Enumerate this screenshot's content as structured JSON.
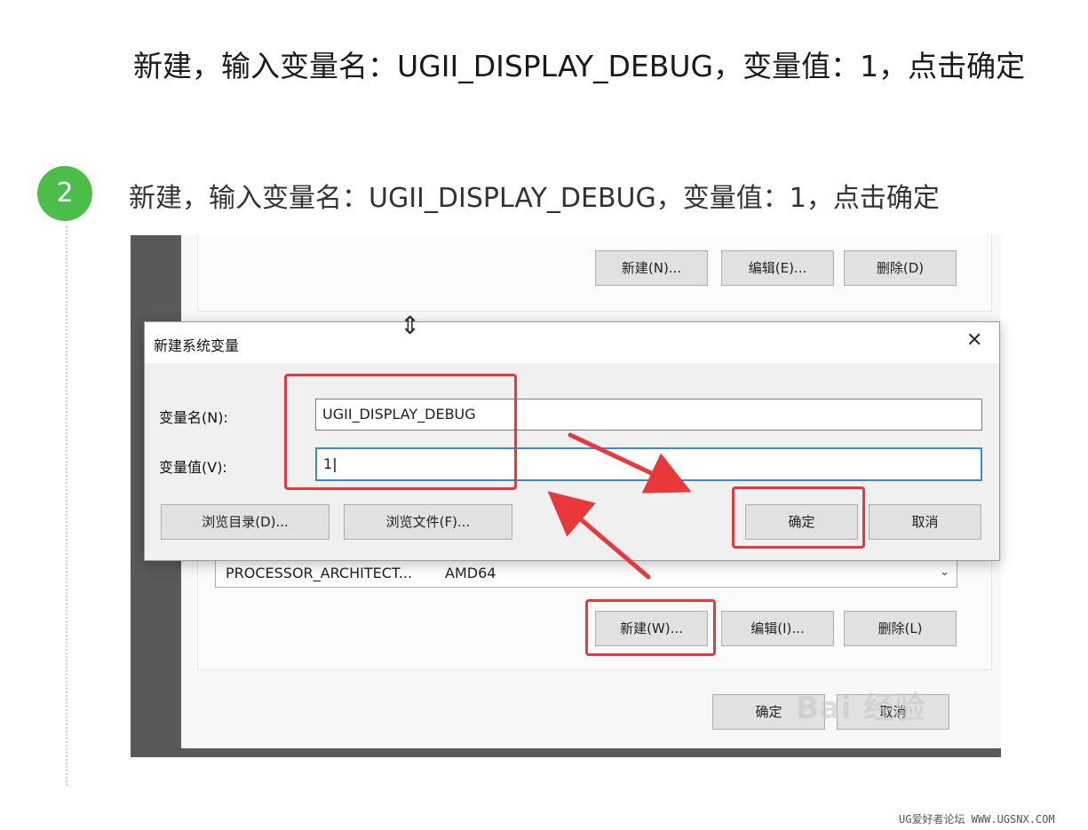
{
  "headline": "新建，输入变量名：UGII_DISPLAY_DEBUG，变量值：1，点击确定",
  "step": {
    "number": "2",
    "text": "新建，输入变量名：UGII_DISPLAY_DEBUG，变量值：1，点击确定",
    "accent_color": "#4cbd4a"
  },
  "background_window": {
    "top_buttons": {
      "new": "新建(N)...",
      "edit": "编辑(E)...",
      "delete": "删除(D)"
    },
    "combo_row": {
      "name": "PROCESSOR_ARCHITECT...",
      "value": "AMD64"
    },
    "bottom_buttons": {
      "new": "新建(W)...",
      "edit": "编辑(I)...",
      "delete": "删除(L)"
    },
    "footer_buttons": {
      "ok": "确定",
      "cancel": "取消"
    }
  },
  "dialog": {
    "title": "新建系统变量",
    "close_icon": "close-icon",
    "var_name_label": "变量名(N):",
    "var_name_value": "UGII_DISPLAY_DEBUG",
    "var_value_label": "变量值(V):",
    "var_value_value": "1",
    "browse_dir": "浏览目录(D)...",
    "browse_file": "浏览文件(F)...",
    "ok": "确定",
    "cancel": "取消"
  },
  "annotation_color": "#e8383b",
  "watermark": "Bai 经验",
  "footer": "UG爱好者论坛 WWW.UGSNX.COM"
}
